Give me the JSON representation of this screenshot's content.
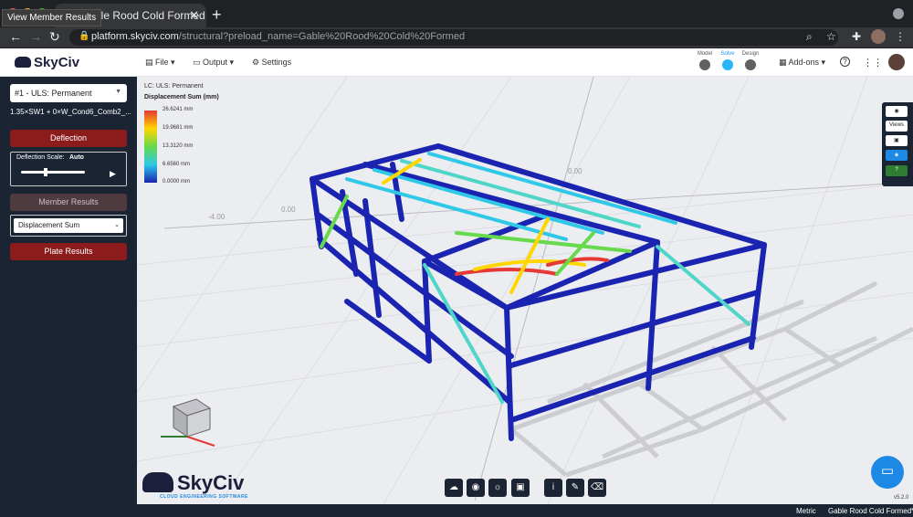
{
  "browser": {
    "tab_title": "Gable Rood Cold Formed | Sk",
    "tooltip": "View Member Results",
    "url_host": "platform.skyciv.com",
    "url_path": "/structural?preload_name=Gable%20Rood%20Cold%20Formed",
    "new_tab": "+",
    "close_tab": "✕"
  },
  "header": {
    "logo": "SkyCiv",
    "menu": {
      "file": "File",
      "output": "Output",
      "settings": "Settings"
    },
    "stages": {
      "model": "Model",
      "solve": "Solve",
      "design": "Design"
    },
    "addons": "Add-ons",
    "help": "?"
  },
  "sidebar": {
    "load_case": "#1 - ULS: Permanent",
    "combo": "1.35×SW1 + 0×W_Cond6_Comb2_...",
    "deflection_button": "Deflection",
    "deflection_scale_label": "Deflection Scale:",
    "deflection_scale_value": "Auto",
    "member_results_button": "Member Results",
    "result_type": "Displacement Sum",
    "plate_results_button": "Plate Results"
  },
  "viewport": {
    "lc_label": "LC: ULS: Permanent",
    "legend_title": "Displacement Sum (mm)",
    "legend_ticks": [
      "26.6241 mm",
      "19.9681 mm",
      "13.3120 mm",
      "6.6560 mm",
      "0.0000 mm"
    ],
    "grid_labels": [
      "-4.00",
      "0.00",
      "0.00"
    ],
    "right_toolbar": {
      "views": "Views"
    },
    "version": "v5.2.0",
    "brand_subtitle": "CLOUD ENGINEERING SOFTWARE"
  },
  "status": {
    "units": "Metric",
    "project": "Gable Rood Cold Formed*"
  },
  "colors": {
    "sidebar_bg": "#1b2433",
    "accent_red": "#8c1c1c",
    "accent_blue": "#1e88e5",
    "frame_blue": "#1a24b0"
  }
}
